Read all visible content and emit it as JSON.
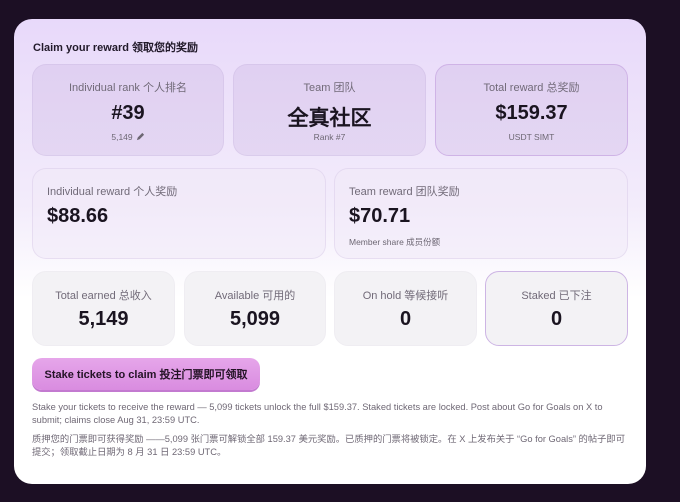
{
  "title": "Claim your reward 领取您的奖励",
  "stats_row1": {
    "individual_rank": {
      "label": "Individual rank 个人排名",
      "value": "#39",
      "sub": "5,149"
    },
    "team": {
      "label": "Team 团队",
      "value": "全真社区",
      "sub": "Rank #7"
    },
    "total_reward": {
      "label": "Total reward 总奖励",
      "value": "$159.37",
      "sub": "USDT SIMT"
    }
  },
  "stats_row2": {
    "individual_reward": {
      "label": "Individual reward 个人奖励",
      "value": "$88.66"
    },
    "team_reward": {
      "label": "Team reward 团队奖励",
      "value": "$70.71",
      "sub": "Member share 成员份额"
    }
  },
  "stats_row3": {
    "total_earned": {
      "label": "Total earned 总收入",
      "value": "5,149"
    },
    "available": {
      "label": "Available 可用的",
      "value": "5,099"
    },
    "on_hold": {
      "label": "On hold 等候接听",
      "value": "0"
    },
    "staked": {
      "label": "Staked 已下注",
      "value": "0"
    }
  },
  "cta": {
    "label": "Stake tickets to claim 投注门票即可领取"
  },
  "info_en": "Stake your tickets to receive the reward — 5,099 tickets unlock the full $159.37. Staked tickets are locked. Post about Go for Goals on X to submit; claims close Aug 31, 23:59 UTC.",
  "info_cn": "质押您的门票即可获得奖励 ——5,099 张门票可解锁全部 159.37 美元奖励。已质押的门票将被锁定。在 X 上发布关于 “Go for Goals” 的帖子即可提交；领取截止日期为 8 月 31 日 23:59 UTC。",
  "icons": {
    "edit": "pencil-icon"
  },
  "colors": {
    "background": "#1c0f24",
    "accent": "#dd95e4",
    "highlight_border": "#cfb3e6"
  }
}
